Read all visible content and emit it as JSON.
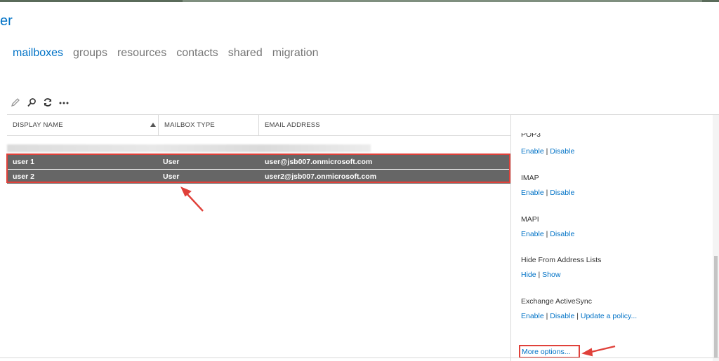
{
  "header": {
    "title": "er"
  },
  "tabs": [
    {
      "label": "mailboxes",
      "active": true
    },
    {
      "label": "groups"
    },
    {
      "label": "resources"
    },
    {
      "label": "contacts"
    },
    {
      "label": "shared"
    },
    {
      "label": "migration"
    }
  ],
  "toolbar": {
    "icons": [
      "edit-icon",
      "search-icon",
      "refresh-icon",
      "more-icon"
    ]
  },
  "table": {
    "columns": [
      "DISPLAY NAME",
      "MAILBOX TYPE",
      "EMAIL ADDRESS"
    ],
    "sort_column": "DISPLAY NAME",
    "rows": [
      {
        "name": "user 1",
        "type": "User",
        "email": "user@jsb007.onmicrosoft.com"
      },
      {
        "name": "user 2",
        "type": "User",
        "email": "user2@jsb007.onmicrosoft.com"
      }
    ]
  },
  "details": {
    "sections": [
      {
        "title": "POP3",
        "links": [
          "Enable",
          "Disable"
        ]
      },
      {
        "title": "IMAP",
        "links": [
          "Enable",
          "Disable"
        ]
      },
      {
        "title": "MAPI",
        "links": [
          "Enable",
          "Disable"
        ]
      },
      {
        "title": "Hide From Address Lists",
        "links": [
          "Hide",
          "Show"
        ]
      },
      {
        "title": "Exchange ActiveSync",
        "links": [
          "Enable",
          "Disable",
          "Update a policy..."
        ]
      }
    ],
    "more_options": "More options..."
  },
  "colors": {
    "accent": "#0072c6",
    "selected_row": "#666666",
    "annotation": "#e0413a"
  }
}
